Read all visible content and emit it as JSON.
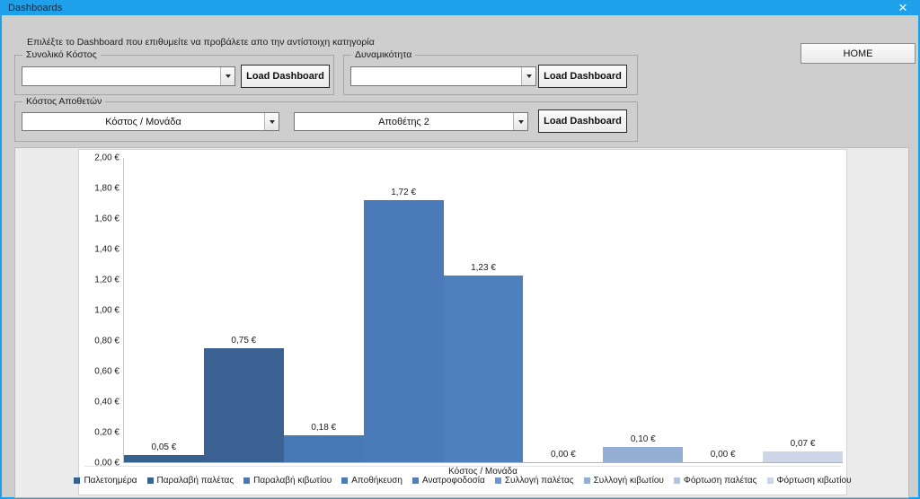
{
  "window": {
    "title": "Dashboards",
    "close_icon": "close-icon"
  },
  "hint": "Επιλέξτε το Dashboard που επιθυμείτε να προβάλετε απο την αντίστοιχη κατηγορία",
  "groups": {
    "total_cost": {
      "label": "Συνολικό Κόστος",
      "combo_value": "",
      "button": "Load Dashboard"
    },
    "capacity": {
      "label": "Δυναμικότητα",
      "combo_value": "",
      "button": "Load Dashboard"
    },
    "warehouse_cost": {
      "label": "Κόστος Αποθετών",
      "combo_metric_value": "Κόστος / Μονάδα",
      "combo_warehouse_value": "Αποθέτης 2",
      "button": "Load Dashboard"
    }
  },
  "home_button": "HOME",
  "chart_data": {
    "type": "bar",
    "title": "",
    "xlabel": "Κόστος / Μονάδα",
    "ylabel": "",
    "ylim": [
      0,
      2.0
    ],
    "ytick_labels": [
      "2,00 €",
      "1,80 €",
      "1,60 €",
      "1,40 €",
      "1,20 €",
      "1,00 €",
      "0,80 €",
      "0,60 €",
      "0,40 €",
      "0,20 €",
      "0,00 €"
    ],
    "ytick_values": [
      2.0,
      1.8,
      1.6,
      1.4,
      1.2,
      1.0,
      0.8,
      0.6,
      0.4,
      0.2,
      0.0
    ],
    "grid": false,
    "legend_position": "bottom",
    "categories": [
      "Παλετοημέρα",
      "Παραλαβή παλέτας",
      "Παραλαβή κιβωτίου",
      "Αποθήκευση",
      "Ανατροφοδοσία",
      "Συλλογή παλέτας",
      "Συλλογή κιβωτίου",
      "Φόρτωση παλέτας",
      "Φόρτωση κιβωτίου"
    ],
    "values": [
      0.05,
      0.75,
      0.18,
      1.72,
      1.23,
      0.0,
      0.1,
      0.0,
      0.07
    ],
    "data_labels": [
      "0,05 €",
      "0,75 €",
      "0,18 €",
      "1,72 €",
      "1,23 €",
      "0,00 €",
      "0,10 €",
      "0,00 €",
      "0,07 €"
    ],
    "colors": [
      "#36618f",
      "#3b6293",
      "#4779b4",
      "#4a7ab8",
      "#4d80bd",
      "#6f96c9",
      "#94aed4",
      "#b3c4de",
      "#ccd6e8"
    ]
  }
}
